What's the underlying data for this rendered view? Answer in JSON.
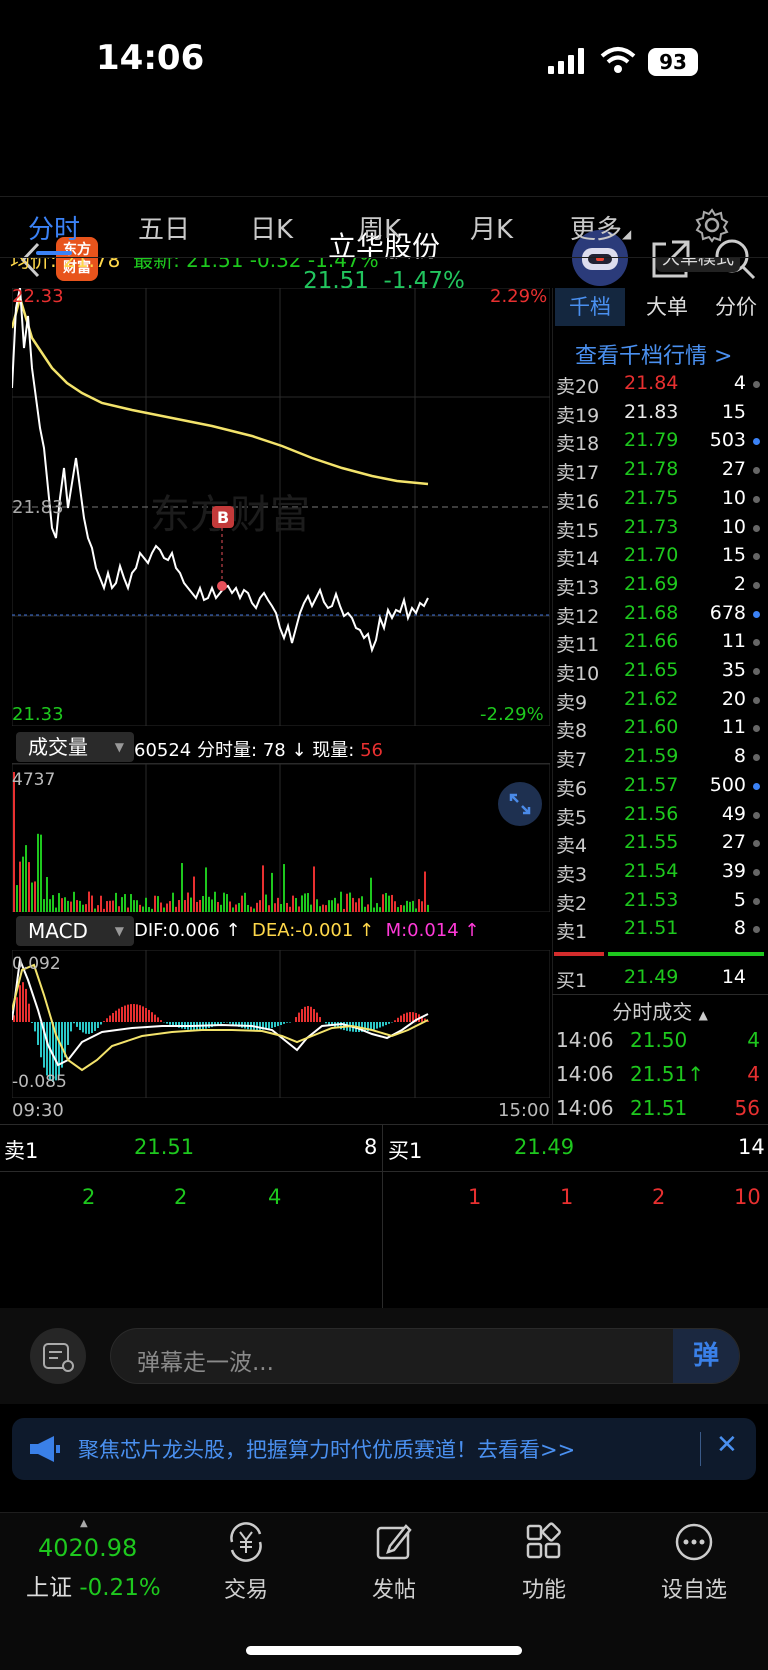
{
  "status_bar": {
    "time": "14:06",
    "battery": "93"
  },
  "header": {
    "title": "立华股份",
    "price": "21.51",
    "change_pct": "-1.47%",
    "logo_line1": "东方",
    "logo_line2": "财富"
  },
  "tabs": [
    {
      "label": "分时",
      "active": true
    },
    {
      "label": "五日"
    },
    {
      "label": "日K"
    },
    {
      "label": "周K"
    },
    {
      "label": "月K"
    },
    {
      "label": "更多"
    }
  ],
  "info_bar": {
    "avg_label": "均价: 21.78",
    "latest_label": "最新: 21.51 -0.32 -1.47%",
    "mode": "大单模式"
  },
  "price_chart": {
    "high_price": "22.33",
    "high_pct": "2.29%",
    "low_price": "21.33",
    "low_pct": "-2.29%",
    "prev_close": "21.83",
    "watermark": "东方财富",
    "marker": "B"
  },
  "volume_section": {
    "selector": "成交量",
    "total": "60524",
    "fs_label": "分时量:",
    "fs_value": "78",
    "arrow": "↓",
    "now_label": "现量:",
    "now_value": "56",
    "max": "4737"
  },
  "macd_section": {
    "selector": "MACD",
    "dif": "DIF:0.006 ↑",
    "dea": "DEA:-0.001 ↑",
    "m": "M:0.014 ↑",
    "top": "0.092",
    "bottom": "-0.085",
    "time_start": "09:30",
    "time_end": "15:00"
  },
  "order_book": {
    "tabs": [
      "千档",
      "大单",
      "分价"
    ],
    "link": "查看千档行情 >",
    "sells": [
      {
        "label": "卖20",
        "price": "21.84",
        "vol": "4",
        "pc": "red",
        "dot": "gray"
      },
      {
        "label": "卖19",
        "price": "21.83",
        "vol": "15",
        "pc": "white",
        "dot": "none"
      },
      {
        "label": "卖18",
        "price": "21.79",
        "vol": "503",
        "pc": "green",
        "dot": "blue"
      },
      {
        "label": "卖17",
        "price": "21.78",
        "vol": "27",
        "pc": "green",
        "dot": "gray"
      },
      {
        "label": "卖16",
        "price": "21.75",
        "vol": "10",
        "pc": "green",
        "dot": "gray"
      },
      {
        "label": "卖15",
        "price": "21.73",
        "vol": "10",
        "pc": "green",
        "dot": "gray"
      },
      {
        "label": "卖14",
        "price": "21.70",
        "vol": "15",
        "pc": "green",
        "dot": "gray"
      },
      {
        "label": "卖13",
        "price": "21.69",
        "vol": "2",
        "pc": "green",
        "dot": "gray"
      },
      {
        "label": "卖12",
        "price": "21.68",
        "vol": "678",
        "pc": "green",
        "dot": "blue"
      },
      {
        "label": "卖11",
        "price": "21.66",
        "vol": "11",
        "pc": "green",
        "dot": "gray"
      },
      {
        "label": "卖10",
        "price": "21.65",
        "vol": "35",
        "pc": "green",
        "dot": "gray"
      },
      {
        "label": "卖9",
        "price": "21.62",
        "vol": "20",
        "pc": "green",
        "dot": "gray"
      },
      {
        "label": "卖8",
        "price": "21.60",
        "vol": "11",
        "pc": "green",
        "dot": "gray"
      },
      {
        "label": "卖7",
        "price": "21.59",
        "vol": "8",
        "pc": "green",
        "dot": "gray"
      },
      {
        "label": "卖6",
        "price": "21.57",
        "vol": "500",
        "pc": "green",
        "dot": "blue"
      },
      {
        "label": "卖5",
        "price": "21.56",
        "vol": "49",
        "pc": "green",
        "dot": "gray"
      },
      {
        "label": "卖4",
        "price": "21.55",
        "vol": "27",
        "pc": "green",
        "dot": "gray"
      },
      {
        "label": "卖3",
        "price": "21.54",
        "vol": "39",
        "pc": "green",
        "dot": "gray"
      },
      {
        "label": "卖2",
        "price": "21.53",
        "vol": "5",
        "pc": "green",
        "dot": "gray"
      },
      {
        "label": "卖1",
        "price": "21.51",
        "vol": "8",
        "pc": "green",
        "dot": "gray"
      }
    ],
    "buy1": {
      "label": "买1",
      "price": "21.49",
      "vol": "14"
    },
    "ticks_title": "分时成交",
    "ticks": [
      {
        "time": "14:06",
        "price": "21.50",
        "vol": "4",
        "vc": "green"
      },
      {
        "time": "14:06",
        "price": "21.51↑",
        "vol": "4",
        "vc": "red"
      },
      {
        "time": "14:06",
        "price": "21.51",
        "vol": "56",
        "vc": "red"
      }
    ]
  },
  "level_bar": {
    "sell_label": "卖1",
    "sell_price": "21.51",
    "sell_vol": "8",
    "buy_label": "买1",
    "buy_price": "21.49",
    "buy_vol": "14",
    "sell_queue": [
      "2",
      "2",
      "4"
    ],
    "buy_queue": [
      "1",
      "1",
      "2",
      "10"
    ]
  },
  "danmaku": {
    "placeholder": "弹幕走一波...",
    "send": "弹"
  },
  "banner": {
    "text": "聚焦芯片龙头股，把握算力时代优质赛道！去看看>>"
  },
  "bottom_nav": {
    "index_value": "4020.98",
    "index_name": "上证",
    "index_change": "-0.21%",
    "items": [
      "交易",
      "发帖",
      "功能",
      "设自选"
    ]
  },
  "colors": {
    "up": "#e83030",
    "down": "#1ec81e",
    "accent": "#3b82f6",
    "avg_line": "#f3e36b"
  }
}
